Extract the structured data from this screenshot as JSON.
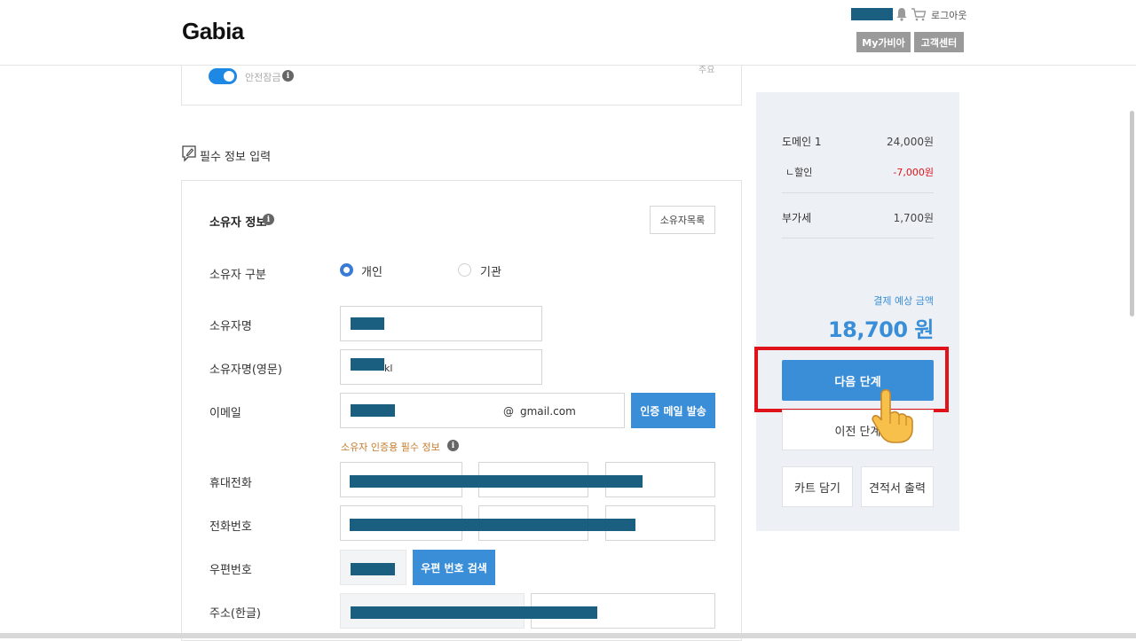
{
  "header": {
    "logo": "Gabia",
    "logout_label": "로그아웃",
    "my_gabia_label": "My가비아",
    "customer_center_label": "고객센터"
  },
  "top_card": {
    "safety_lock_label": "안전잠금",
    "right_fragment": "주요"
  },
  "section": {
    "title": "필수 정보 입력"
  },
  "owner": {
    "title": "소유자 정보",
    "list_button": "소유자목록",
    "type_label": "소유자 구분",
    "type_options": [
      "개인",
      "기관"
    ],
    "type_selected": "개인",
    "name_label": "소유자명",
    "name_en_label": "소유자명(영문)",
    "name_en_value_visible": "kl",
    "email_label": "이메일",
    "email_at": "@",
    "email_domain": "gmail.com",
    "email_verify_button": "인증 메일 발송",
    "required_note": "소유자 인증용 필수 정보",
    "mobile_label": "휴대전화",
    "phone_label": "전화번호",
    "zip_label": "우편번호",
    "zip_search_button": "우편 번호 검색",
    "address_label": "주소(한글)"
  },
  "summary": {
    "domain_label": "도메인 1",
    "domain_price": "24,000원",
    "discount_label": "ㄴ할인",
    "discount_price": "-7,000원",
    "vat_label": "부가세",
    "vat_price": "1,700원",
    "total_label": "결제 예상 금액",
    "total_value": "18,700 원",
    "next_button": "다음 단계",
    "prev_button": "이전 단계",
    "cart_button": "카트 담기",
    "quote_button": "견적서 출력"
  },
  "colors": {
    "accent_blue": "#3a8ed8",
    "toggle_blue": "#1e88e5",
    "highlight_red": "#e0121a",
    "discount_red": "#e0121a",
    "note_orange": "#c47b2c",
    "redaction": "#1a5e80",
    "panel_bg": "#edf1f5"
  }
}
